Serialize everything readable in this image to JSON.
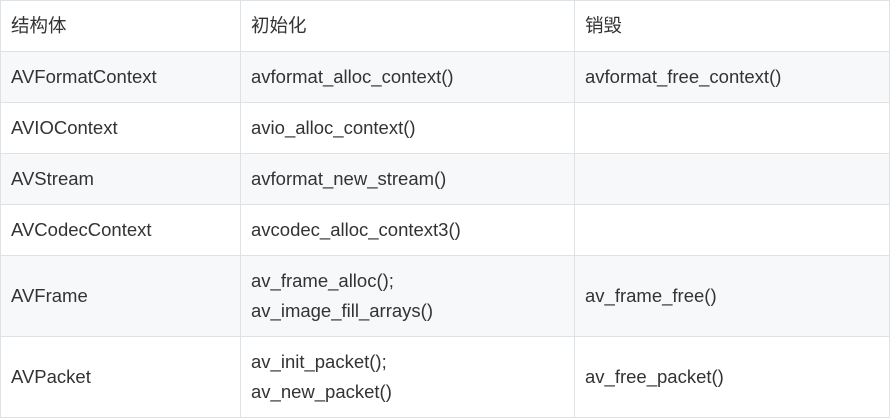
{
  "table": {
    "headers": [
      "结构体",
      "初始化",
      "销毁"
    ],
    "rows": [
      {
        "struct": "AVFormatContext",
        "init": [
          "avformat_alloc_context()"
        ],
        "destroy": [
          "avformat_free_context()"
        ]
      },
      {
        "struct": "AVIOContext",
        "init": [
          "avio_alloc_context()"
        ],
        "destroy": []
      },
      {
        "struct": "AVStream",
        "init": [
          "avformat_new_stream()"
        ],
        "destroy": []
      },
      {
        "struct": "AVCodecContext",
        "init": [
          "avcodec_alloc_context3()"
        ],
        "destroy": []
      },
      {
        "struct": "AVFrame",
        "init": [
          "av_frame_alloc();",
          "av_image_fill_arrays()"
        ],
        "destroy": [
          "av_frame_free()"
        ]
      },
      {
        "struct": "AVPacket",
        "init": [
          "av_init_packet();",
          "av_new_packet()"
        ],
        "destroy": [
          "av_free_packet()"
        ]
      }
    ]
  }
}
